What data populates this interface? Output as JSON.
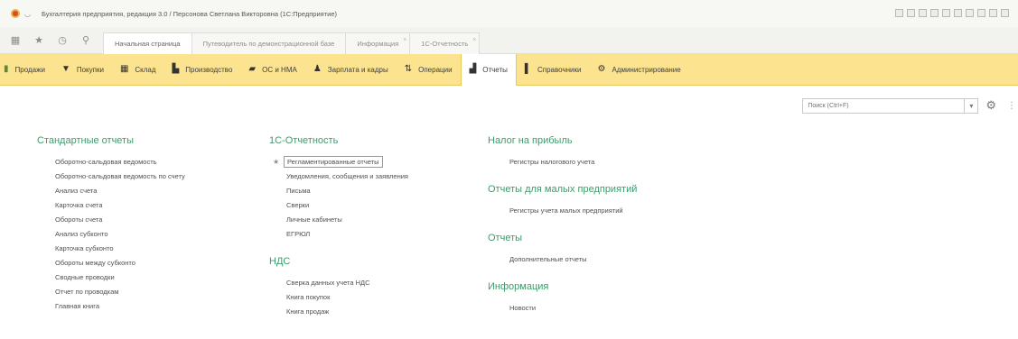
{
  "window": {
    "title": "Бухгалтерия предприятия, редакция 3.0 / Персонова Светлана Викторовна   (1С:Предприятие)"
  },
  "tabs": [
    {
      "label": "Начальная страница",
      "active": true
    },
    {
      "label": "Путеводитель по демонстрационной базе",
      "active": false
    },
    {
      "label": "Информация",
      "active": false
    },
    {
      "label": "1С-Отчетность",
      "active": false
    }
  ],
  "sections": [
    {
      "label": "Продажи",
      "icon": "sales-icon"
    },
    {
      "label": "Покупки",
      "icon": "cart-icon"
    },
    {
      "label": "Склад",
      "icon": "warehouse-icon"
    },
    {
      "label": "Производство",
      "icon": "production-icon"
    },
    {
      "label": "ОС и НМА",
      "icon": "truck-icon"
    },
    {
      "label": "Зарплата и кадры",
      "icon": "person-icon"
    },
    {
      "label": "Операции",
      "icon": "operations-icon"
    },
    {
      "label": "Отчеты",
      "icon": "chart-icon",
      "active": true
    },
    {
      "label": "Справочники",
      "icon": "book-icon"
    },
    {
      "label": "Администрирование",
      "icon": "gear-icon"
    }
  ],
  "search": {
    "placeholder": "Поиск (Ctrl+F)"
  },
  "columns": {
    "standard": {
      "heading": "Стандартные отчеты",
      "items": [
        "Оборотно-сальдовая ведомость",
        "Оборотно-сальдовая ведомость по счету",
        "Анализ счета",
        "Карточка счета",
        "Обороты счета",
        "Анализ субконто",
        "Карточка субконто",
        "Обороты между субконто",
        "Сводные проводки",
        "Отчет по проводкам",
        "Главная книга"
      ]
    },
    "reporting": {
      "heading": "1С-Отчетность",
      "items": [
        "Регламентированные отчеты",
        "Уведомления, сообщения и заявления",
        "Письма",
        "Сверки",
        "Личные кабинеты",
        "ЕГРЮЛ"
      ]
    },
    "vat": {
      "heading": "НДС",
      "items": [
        "Сверка данных учета НДС",
        "Книга покупок",
        "Книга продаж"
      ]
    },
    "profit_tax": {
      "heading": "Налог на прибыль",
      "items": [
        "Регистры налогового учета"
      ]
    },
    "small_business": {
      "heading": "Отчеты для малых предприятий",
      "items": [
        "Регистры учета малых предприятий"
      ]
    },
    "reports": {
      "heading": "Отчеты",
      "items": [
        "Дополнительные отчеты"
      ]
    },
    "info": {
      "heading": "Информация",
      "items": [
        "Новости"
      ]
    }
  }
}
